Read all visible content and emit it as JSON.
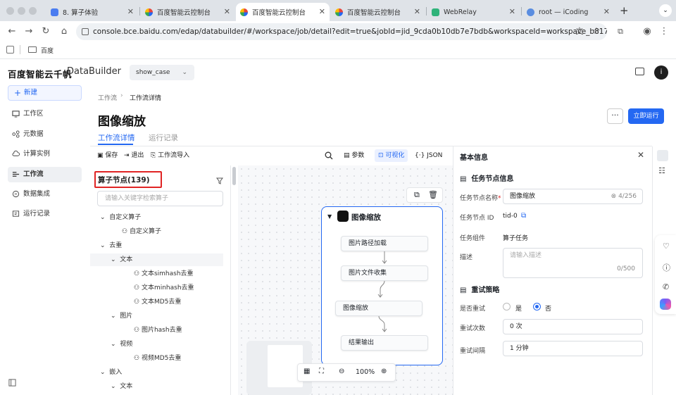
{
  "browser": {
    "tabs": [
      {
        "title": "8. 算子体验"
      },
      {
        "title": "百度智能云控制台"
      },
      {
        "title": "百度智能云控制台"
      },
      {
        "title": "百度智能云控制台"
      },
      {
        "title": "WebRelay"
      },
      {
        "title": "root — iCoding"
      }
    ],
    "url": "console.bce.baidu.com/edap/databuilder/#/workspace/job/detail?edit=true&jobId=jid_9cda0b10db7e7bdb&workspaceId=workspace_b817_b6...",
    "bookmark": "百度",
    "avatar_letter": "i"
  },
  "app": {
    "brand": "百度智能云千帆",
    "product": "DataBuilder",
    "workspace": "show_case"
  },
  "nav": {
    "new_label": "新建",
    "items": [
      {
        "label": "工作区"
      },
      {
        "label": "元数据"
      },
      {
        "label": "计算实例"
      },
      {
        "label": "工作流"
      },
      {
        "label": "数据集成"
      },
      {
        "label": "运行记录"
      }
    ]
  },
  "main": {
    "breadcrumb_root": "工作流",
    "breadcrumb_current": "工作流详情",
    "title": "图像缩放",
    "tabs": [
      "工作流详情",
      "运行记录"
    ],
    "more": "···",
    "run": "立即运行",
    "toolbar": {
      "save": "保存",
      "exit": "退出",
      "import": "工作流导入",
      "params": "参数",
      "visual": "可视化",
      "json": "JSON"
    }
  },
  "operators": {
    "title": "算子节点(139)",
    "search_placeholder": "请输入关键字检索算子",
    "tree": [
      {
        "label": "自定义算子"
      },
      {
        "label": "自定义算子"
      },
      {
        "label": "去重"
      },
      {
        "label": "文本"
      },
      {
        "label": "文本simhash去重"
      },
      {
        "label": "文本minhash去重"
      },
      {
        "label": "文本MD5去重"
      },
      {
        "label": "图片"
      },
      {
        "label": "图片hash去重"
      },
      {
        "label": "视频"
      },
      {
        "label": "视频MD5去重"
      },
      {
        "label": "嵌入"
      },
      {
        "label": "文本"
      }
    ]
  },
  "flow": {
    "title": "图像缩放",
    "steps": [
      "图片路径加载",
      "图片文件收集",
      "图像缩放",
      "结果输出"
    ],
    "zoom": "100%"
  },
  "details": {
    "header": "基本信息",
    "section_task": "任务节点信息",
    "name_label": "任务节点名称",
    "name_value": "图像缩放",
    "name_count": "4/256",
    "id_label": "任务节点 ID",
    "id_value": "tid-0",
    "component_label": "任务组件",
    "component_value": "算子任务",
    "desc_label": "描述",
    "desc_placeholder": "请输入描述",
    "desc_count": "0/500",
    "section_retry": "重试策略",
    "retry_label": "是否重试",
    "retry_yes": "是",
    "retry_no": "否",
    "retry_count_label": "重试次数",
    "retry_count_value": "0 次",
    "retry_interval_label": "重试间隔",
    "retry_interval_value": "1 分钟"
  },
  "colors": {
    "accent": "#2468f2",
    "highlight": "#e02424"
  }
}
